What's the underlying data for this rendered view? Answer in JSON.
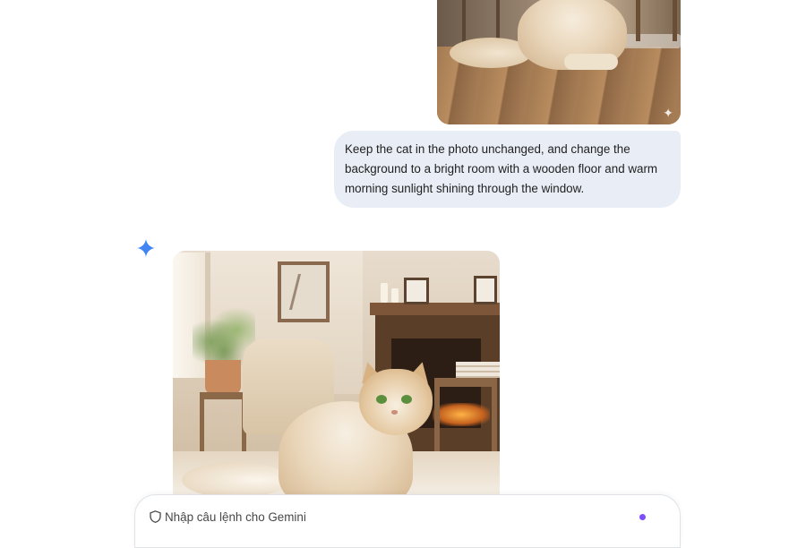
{
  "conversation": {
    "user_image": {
      "alt": "Uploaded photo of a fluffy cream cat",
      "badge_icon": "sparkle-icon"
    },
    "user_message": {
      "text": "Keep the cat in the photo unchanged, and change the\nbackground to a bright room with a wooden floor and warm\nmorning sunlight shining through the window."
    },
    "assistant": {
      "avatar_icon": "gemini-sparkle-icon",
      "generated_image": {
        "alt": "Generated image of the cat in a bright room with wooden floor and warm sunlight"
      }
    }
  },
  "prompt_bar": {
    "placeholder": "Nhập câu lệnh cho Gemini",
    "leading_icon": "shield-icon",
    "status_dot_color": "#7c4dff"
  },
  "colors": {
    "user_bubble_bg": "#e9eef6",
    "gemini_blue": "#4285f4"
  }
}
